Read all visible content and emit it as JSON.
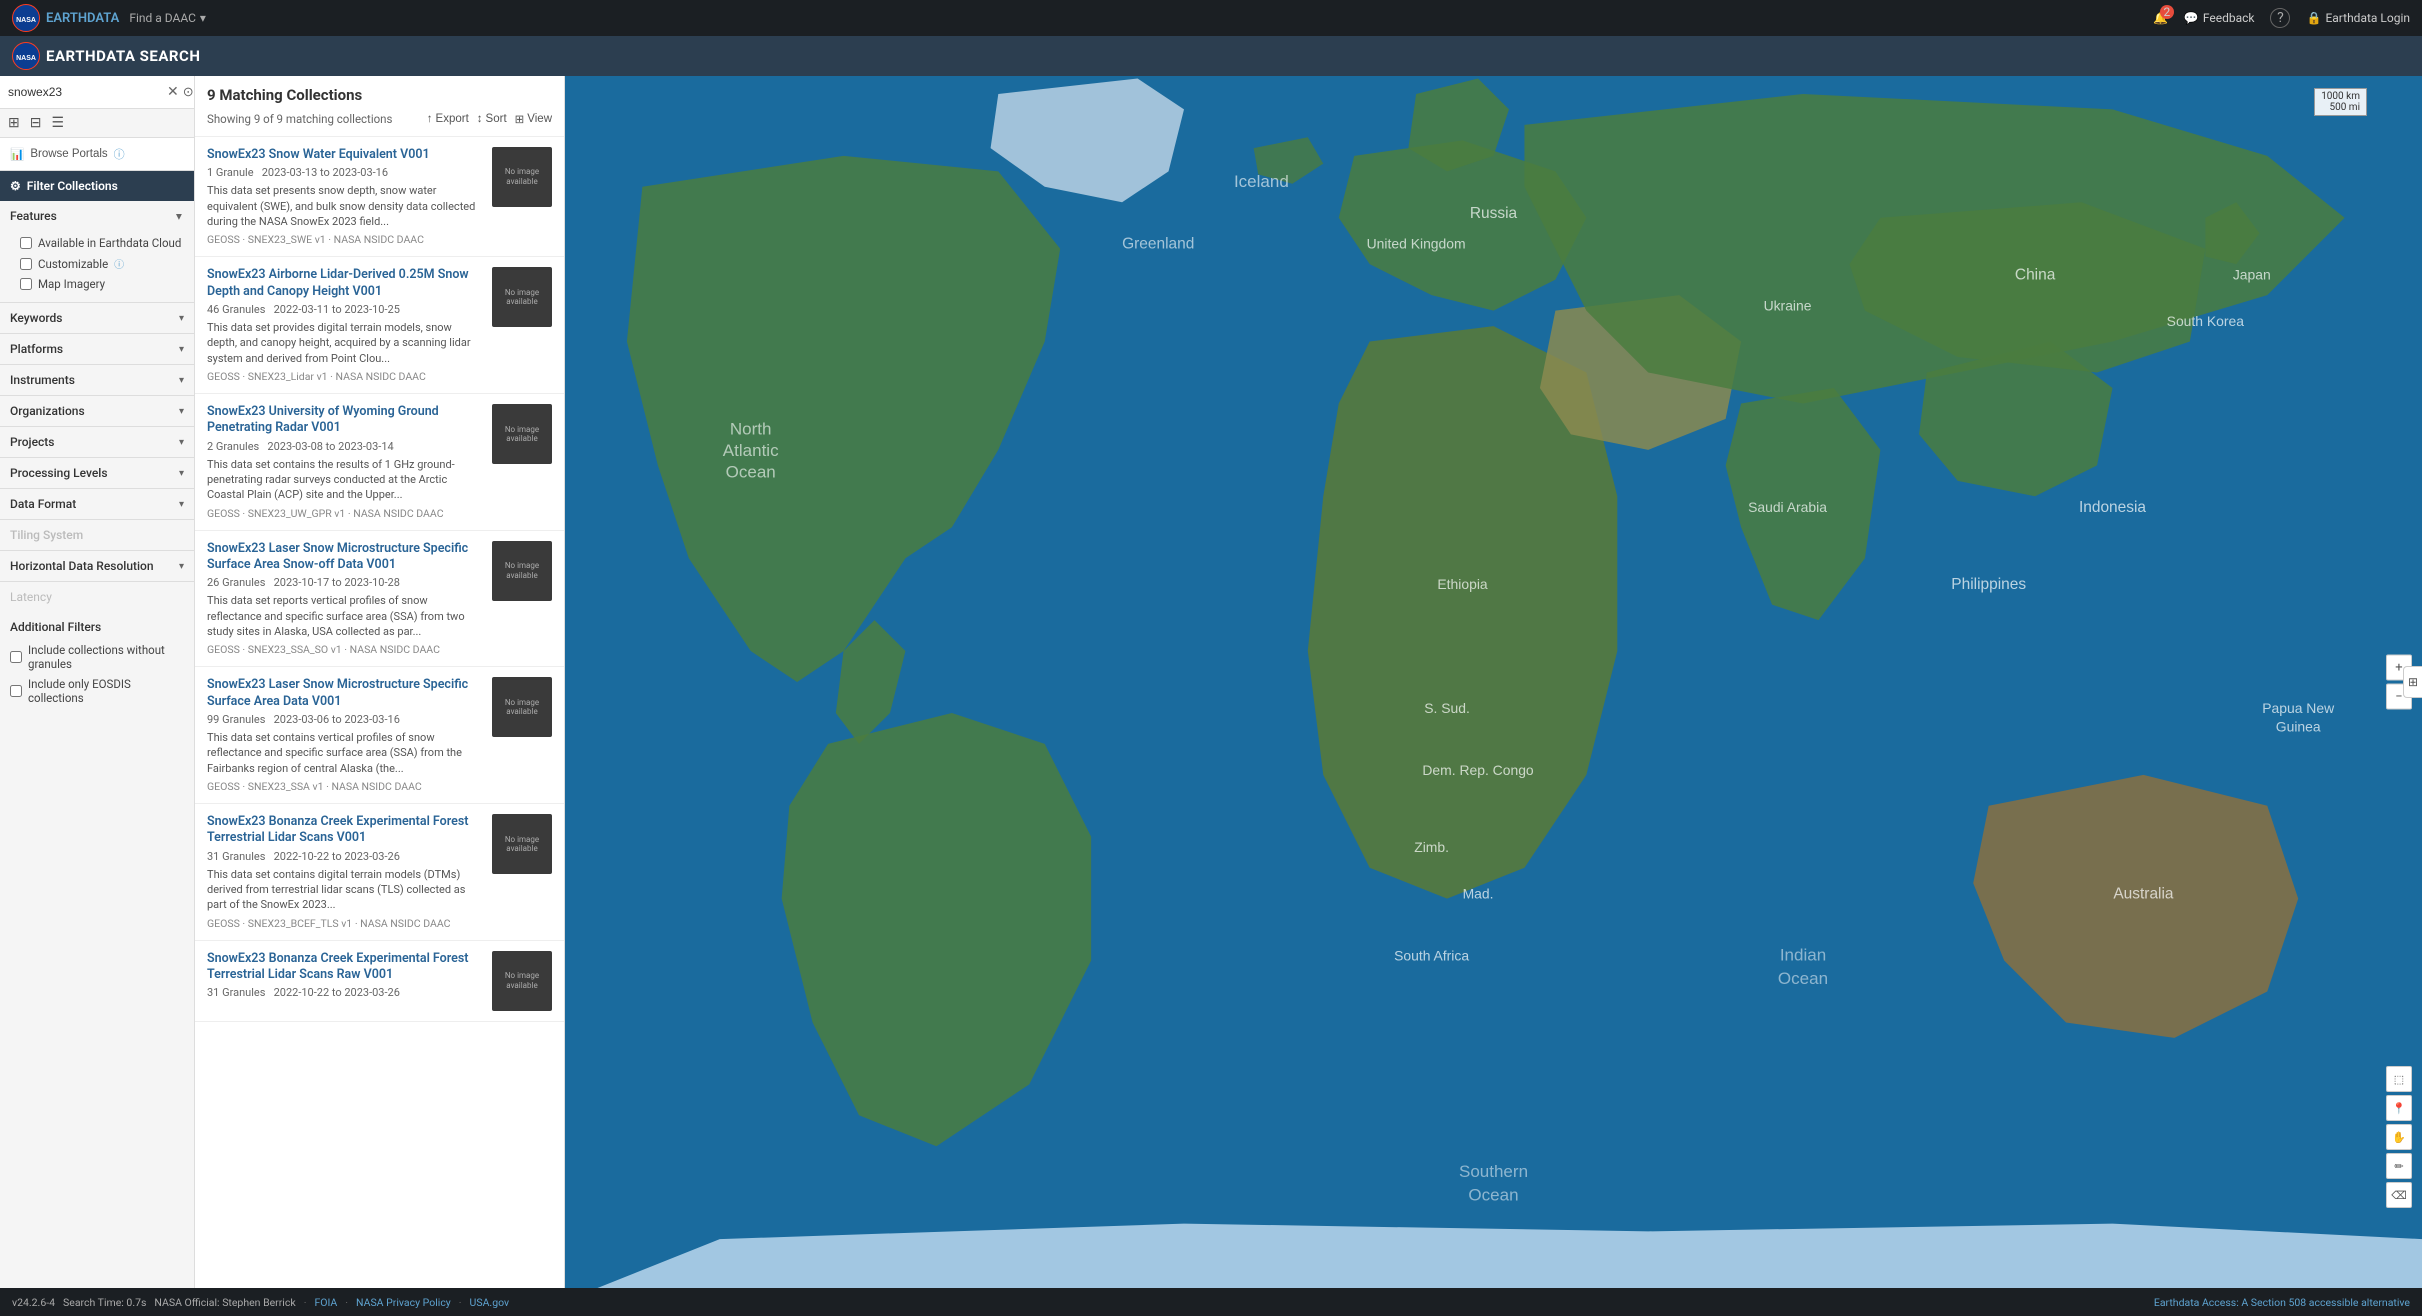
{
  "topNav": {
    "nasa_logo": "NASA",
    "earthdata_label": "EARTHDATA",
    "find_daac_label": "Find a DAAC",
    "notification_count": "2",
    "feedback_label": "Feedback",
    "help_label": "?",
    "login_label": "Earthdata Login"
  },
  "appHeader": {
    "nasa_logo": "NASA",
    "title": "EARTHDATA SEARCH"
  },
  "sidebar": {
    "search_value": "snowex23",
    "browse_portals_label": "Browse Portals",
    "filter_collections_label": "Filter Collections",
    "features_label": "Features",
    "features_items": [
      {
        "label": "Available in Earthdata Cloud",
        "checked": false
      },
      {
        "label": "Customizable",
        "checked": false,
        "info": true
      },
      {
        "label": "Map Imagery",
        "checked": false
      }
    ],
    "keywords_label": "Keywords",
    "platforms_label": "Platforms",
    "instruments_label": "Instruments",
    "organizations_label": "Organizations",
    "projects_label": "Projects",
    "processing_levels_label": "Processing Levels",
    "data_format_label": "Data Format",
    "tiling_system_label": "Tiling System",
    "horizontal_resolution_label": "Horizontal Data Resolution",
    "latency_label": "Latency",
    "additional_filters_label": "Additional Filters",
    "additional_filters_items": [
      {
        "label": "Include collections without granules",
        "checked": false
      },
      {
        "label": "Include only EOSDIS collections",
        "checked": false
      }
    ]
  },
  "results": {
    "title": "9 Matching Collections",
    "count_text": "Showing 9 of 9 matching collections",
    "export_label": "Export",
    "sort_label": "Sort",
    "view_label": "View",
    "items": [
      {
        "title": "SnowEx23 Snow Water Equivalent V001",
        "granules": "1 Granule",
        "date_range": "2023-03-13 to 2023-03-16",
        "description": "This data set presents snow depth, snow water equivalent (SWE), and bulk snow density data collected during the NASA SnowEx 2023 field...",
        "tags": "GEOSS · SNEX23_SWE v1 · NASA NSIDC DAAC",
        "has_image": false
      },
      {
        "title": "SnowEx23 Airborne Lidar-Derived 0.25M Snow Depth and Canopy Height V001",
        "granules": "46 Granules",
        "date_range": "2022-03-11 to 2023-10-25",
        "description": "This data set provides digital terrain models, snow depth, and canopy height, acquired by a scanning lidar system and derived from Point Clou...",
        "tags": "GEOSS · SNEX23_Lidar v1 · NASA NSIDC DAAC",
        "has_image": false
      },
      {
        "title": "SnowEx23 University of Wyoming Ground Penetrating Radar V001",
        "granules": "2 Granules",
        "date_range": "2023-03-08 to 2023-03-14",
        "description": "This data set contains the results of 1 GHz ground-penetrating radar surveys conducted at the Arctic Coastal Plain (ACP) site and the Upper...",
        "tags": "GEOSS · SNEX23_UW_GPR v1 · NASA NSIDC DAAC",
        "has_image": false
      },
      {
        "title": "SnowEx23 Laser Snow Microstructure Specific Surface Area Snow-off Data V001",
        "granules": "26 Granules",
        "date_range": "2023-10-17 to 2023-10-28",
        "description": "This data set reports vertical profiles of snow reflectance and specific surface area (SSA) from two study sites in Alaska, USA collected as par...",
        "tags": "GEOSS · SNEX23_SSA_SO v1 · NASA NSIDC DAAC",
        "has_image": false
      },
      {
        "title": "SnowEx23 Laser Snow Microstructure Specific Surface Area Data V001",
        "granules": "99 Granules",
        "date_range": "2023-03-06 to 2023-03-16",
        "description": "This data set contains vertical profiles of snow reflectance and specific surface area (SSA) from the Fairbanks region of central Alaska (the...",
        "tags": "GEOSS · SNEX23_SSA v1 · NASA NSIDC DAAC",
        "has_image": false
      },
      {
        "title": "SnowEx23 Bonanza Creek Experimental Forest Terrestrial Lidar Scans V001",
        "granules": "31 Granules",
        "date_range": "2022-10-22 to 2023-03-26",
        "description": "This data set contains digital terrain models (DTMs) derived from terrestrial lidar scans (TLS) collected as part of the SnowEx 2023...",
        "tags": "GEOSS · SNEX23_BCEF_TLS v1 · NASA NSIDC DAAC",
        "has_image": false
      },
      {
        "title": "SnowEx23 Bonanza Creek Experimental Forest Terrestrial Lidar Scans Raw V001",
        "granules": "31 Granules",
        "date_range": "2022-10-22 to 2023-03-26",
        "description": "",
        "tags": "",
        "has_image": false
      }
    ]
  },
  "map": {
    "scale_1": "1000 km",
    "scale_2": "500 mi"
  },
  "bottomBar": {
    "version": "v24.2.6-4",
    "search_time": "Search Time: 0.7s",
    "official_label": "NASA Official: Stephen Berrick",
    "foia_label": "FOIA",
    "privacy_label": "NASA Privacy Policy",
    "gov_label": "USA.gov",
    "accessibility_label": "Earthdata Access: A Section 508 accessible alternative"
  }
}
